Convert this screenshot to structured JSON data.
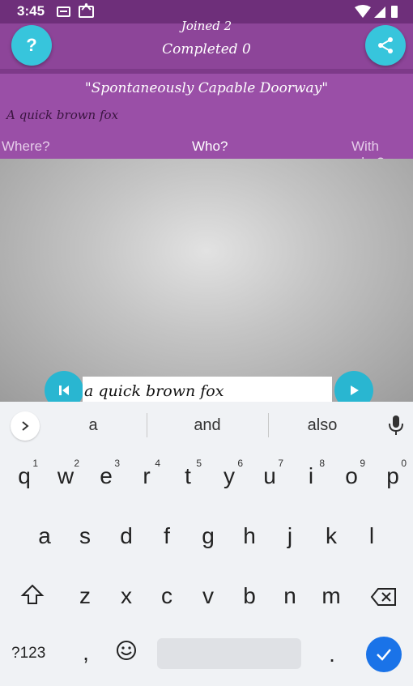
{
  "status_bar": {
    "time": "3:45"
  },
  "header": {
    "joined": "Joined 2",
    "completed": "Completed 0",
    "help_label": "?",
    "story_title": "\"Spontaneously Capable Doorway\"",
    "story_text": "A quick brown fox",
    "questions": {
      "where": "Where?",
      "who": "Who?",
      "with_who": "With who?"
    }
  },
  "input": {
    "value": "a quick brown fox"
  },
  "keyboard": {
    "suggestions": [
      "a",
      "and",
      "also"
    ],
    "row1": [
      "q",
      "w",
      "e",
      "r",
      "t",
      "y",
      "u",
      "i",
      "o",
      "p"
    ],
    "row1_hints": [
      "1",
      "2",
      "3",
      "4",
      "5",
      "6",
      "7",
      "8",
      "9",
      "0"
    ],
    "row2": [
      "a",
      "s",
      "d",
      "f",
      "g",
      "h",
      "j",
      "k",
      "l"
    ],
    "row3": [
      "z",
      "x",
      "c",
      "v",
      "b",
      "n",
      "m"
    ],
    "symbols_label": "?123",
    "comma": ",",
    "period": "."
  },
  "colors": {
    "purple": "#9a4fa7",
    "accent": "#37c5dc",
    "keyboard_action": "#1a73e8"
  }
}
